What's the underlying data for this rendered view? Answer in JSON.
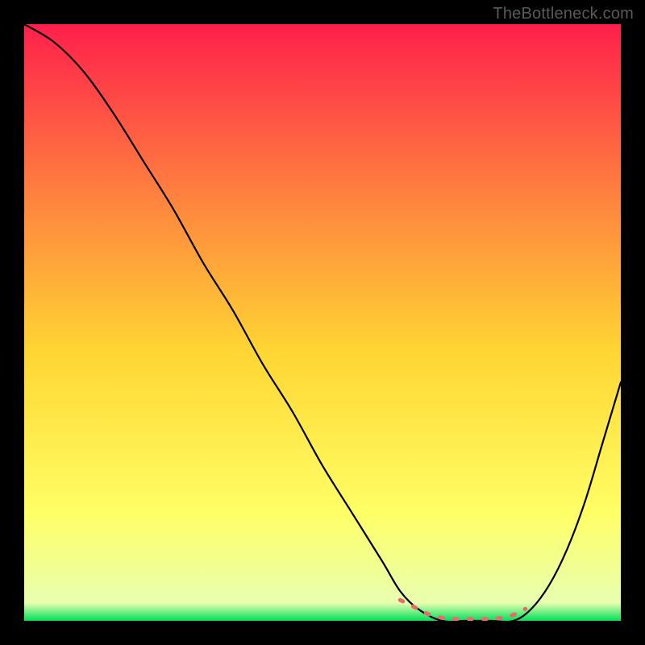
{
  "watermark": "TheBottleneck.com",
  "chart_data": {
    "type": "line",
    "title": "",
    "xlabel": "",
    "ylabel": "",
    "xlim": [
      0,
      100
    ],
    "ylim": [
      0,
      100
    ],
    "grid": false,
    "legend": false,
    "background_gradient": {
      "top": "#ff1f4b",
      "mid1": "#ff7f3f",
      "mid2": "#ffd633",
      "mid3": "#ffff66",
      "bottom": "#00e05a"
    },
    "series": [
      {
        "name": "curve",
        "color": "#000000",
        "x": [
          0,
          5,
          10,
          15,
          20,
          25,
          30,
          35,
          40,
          45,
          50,
          55,
          60,
          63,
          66,
          70,
          74,
          78,
          82,
          85,
          88,
          91,
          94,
          97,
          100
        ],
        "y": [
          100,
          97,
          92,
          85,
          77,
          69,
          60,
          52,
          43,
          35,
          26,
          18,
          10,
          5,
          2,
          0,
          0,
          0,
          0,
          2,
          6,
          12,
          20,
          30,
          40
        ]
      },
      {
        "name": "optimal-zone",
        "color": "#e86a6a",
        "style": "dashed",
        "x": [
          63,
          66,
          68,
          70,
          72,
          75,
          78,
          80,
          82,
          84
        ],
        "y": [
          3.5,
          2,
          1,
          0.5,
          0.3,
          0.3,
          0.3,
          0.5,
          1,
          2
        ]
      }
    ],
    "annotations": []
  }
}
